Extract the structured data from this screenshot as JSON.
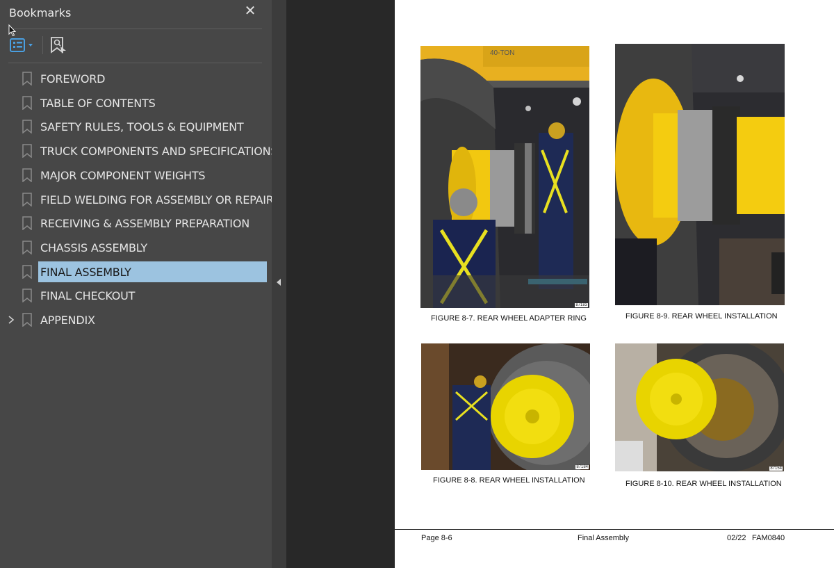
{
  "panel": {
    "title": "Bookmarks",
    "close_icon": "close-icon",
    "toolbar": {
      "options_icon": "list-options-icon",
      "find_icon": "find-bookmark-icon"
    }
  },
  "bookmarks": [
    {
      "label": "FOREWORD",
      "expandable": false,
      "selected": false
    },
    {
      "label": "TABLE OF CONTENTS",
      "expandable": false,
      "selected": false
    },
    {
      "label": "SAFETY RULES, TOOLS & EQUIPMENT",
      "expandable": false,
      "selected": false
    },
    {
      "label": "TRUCK COMPONENTS AND SPECIFICATIONS",
      "expandable": false,
      "selected": false
    },
    {
      "label": "MAJOR COMPONENT WEIGHTS",
      "expandable": false,
      "selected": false
    },
    {
      "label": "FIELD WELDING FOR ASSEMBLY OR REPAIR",
      "expandable": false,
      "selected": false
    },
    {
      "label": "RECEIVING & ASSEMBLY PREPARATION",
      "expandable": false,
      "selected": false
    },
    {
      "label": "CHASSIS ASSEMBLY",
      "expandable": false,
      "selected": false
    },
    {
      "label": "FINAL ASSEMBLY",
      "expandable": false,
      "selected": true
    },
    {
      "label": "FINAL CHECKOUT",
      "expandable": false,
      "selected": false
    },
    {
      "label": "APPENDIX",
      "expandable": true,
      "selected": false
    }
  ],
  "document": {
    "figures": [
      {
        "caption": "FIGURE 8-7. REAR WHEEL ADAPTER RING",
        "number": "87183",
        "sign_text": "40-TON"
      },
      {
        "caption": "FIGURE 8-9. REAR WHEEL INSTALLATION",
        "number": ""
      },
      {
        "caption": "FIGURE 8-8. REAR WHEEL INSTALLATION",
        "number": "87184"
      },
      {
        "caption": "FIGURE 8-10. REAR WHEEL INSTALLATION",
        "number": "87154"
      }
    ],
    "footer": {
      "page": "Page 8-6",
      "section": "Final Assembly",
      "date": "02/22",
      "doc_id": "FAM0840"
    }
  },
  "colors": {
    "panel_bg": "#474747",
    "selection": "#9cc3e0",
    "accent_blue": "#4a9fe0",
    "equipment_yellow": "#f0c814"
  }
}
